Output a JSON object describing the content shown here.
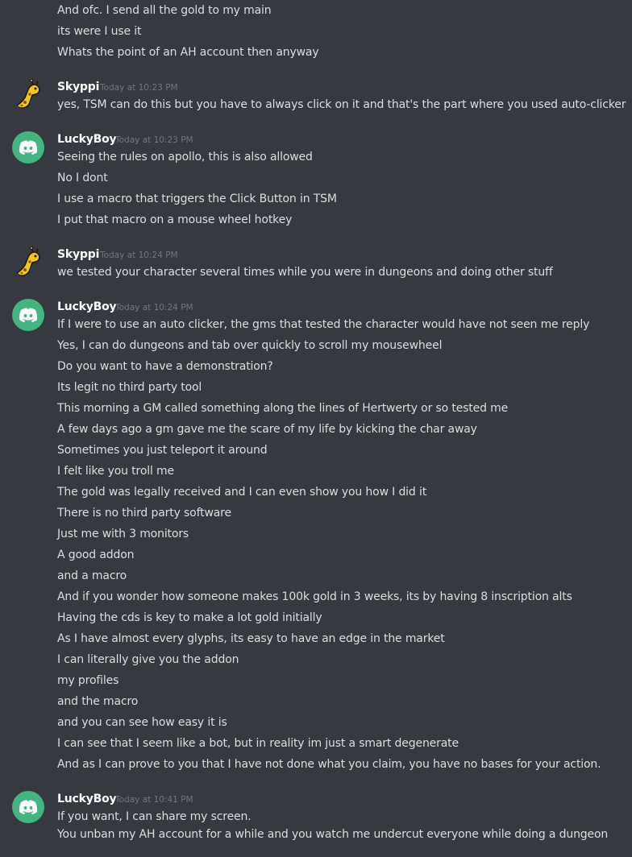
{
  "colors": {
    "background": "#36393f",
    "text": "#dcddde",
    "username": "#ffffff",
    "timestamp": "#72767d",
    "discord_avatar": "#43b581"
  },
  "pre_lines": [
    "And ofc. I send all the gold to my main",
    "its were I use it",
    "Whats the point of an AH account then anyway"
  ],
  "messages": [
    {
      "author": "Skyppi",
      "timestamp": "Today at 10:23 PM",
      "avatar_icon": "giraffe-avatar-icon",
      "lines": [
        "yes, TSM can do this but you have to always click on it and that's the part where you used auto-clicker"
      ]
    },
    {
      "author": "LuckyBoy",
      "timestamp": "Today at 10:23 PM",
      "avatar_icon": "discord-default-avatar-icon",
      "lines": [
        "Seeing the rules on apollo, this is also allowed",
        "No I dont",
        "I use a macro that triggers the Click Button in TSM",
        "I put that macro on a mouse wheel hotkey"
      ]
    },
    {
      "author": "Skyppi",
      "timestamp": "Today at 10:24 PM",
      "avatar_icon": "giraffe-avatar-icon",
      "lines": [
        "we tested your character several times while you were in dungeons and doing other stuff"
      ]
    },
    {
      "author": "LuckyBoy",
      "timestamp": "Today at 10:24 PM",
      "avatar_icon": "discord-default-avatar-icon",
      "lines": [
        "If I were to use an auto clicker, the gms that tested the character would have not seen me reply",
        "Yes, I can do dungeons and tab over quickly to scroll my mousewheel",
        "Do you want to have a demonstration?",
        "Its legit no third party tool",
        "This morning a GM called something along the lines of Hertwerty or so tested me",
        "A few days ago a gm gave me the scare of my life by kicking the char away",
        "Sometimes you just teleport it around",
        "I felt like you troll me",
        "The gold was legally received and I can even show you how I did it",
        "There is no third party software",
        "Just me with 3 monitors",
        "A good addon",
        "and a macro",
        "And if you wonder how someone makes 100k gold in 3 weeks, its by having 8 inscription alts",
        "Having the cds is key to make a lot gold initially",
        "As I have almost every glyphs, its easy to have an edge in the market",
        "I can literally give you the addon",
        "my profiles",
        "and the macro",
        "and you can see how easy it is",
        "I can see that I seem like a bot, but in reality im just a smart degenerate",
        "And as I can prove to you that I have not done what you claim, you have no bases for your action."
      ]
    },
    {
      "author": "LuckyBoy",
      "timestamp": "Today at 10:41 PM",
      "avatar_icon": "discord-default-avatar-icon",
      "lines": [
        "If you want, I can share my screen.",
        "You unban my AH account for a while and you watch me undercut everyone while doing a dungeon"
      ]
    }
  ]
}
